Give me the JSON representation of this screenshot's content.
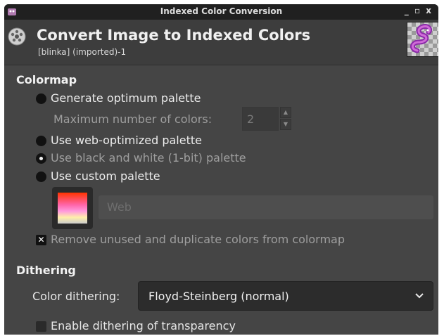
{
  "window": {
    "title": "Indexed Color Conversion",
    "controls": "_ ▫ x"
  },
  "header": {
    "title": "Convert Image to Indexed Colors",
    "subtitle": "[blinka] (imported)-1"
  },
  "colormap": {
    "heading": "Colormap",
    "options": [
      {
        "label": "Generate optimum palette",
        "selected": false,
        "enabled": true
      },
      {
        "label": "Use web-optimized palette",
        "selected": false,
        "enabled": true
      },
      {
        "label": "Use black and white (1-bit) palette",
        "selected": true,
        "enabled": false
      },
      {
        "label": "Use custom palette",
        "selected": false,
        "enabled": true
      }
    ],
    "max_colors_label": "Maximum number of colors:",
    "max_colors_value": "2",
    "custom_palette_name": "Web",
    "remove_unused_label": "Remove unused and duplicate colors from colormap",
    "remove_unused_checked": true
  },
  "dithering": {
    "heading": "Dithering",
    "color_dithering_label": "Color dithering:",
    "color_dithering_value": "Floyd-Steinberg (normal)",
    "transparency_label": "Enable dithering of transparency",
    "transparency_checked": false
  },
  "colors": {
    "dialog_bg": "#454545",
    "titlebar_bg": "#202020",
    "header_bg": "#3d3d3d",
    "text": "#e8e8e8",
    "dim_text": "#9e9e9e"
  }
}
